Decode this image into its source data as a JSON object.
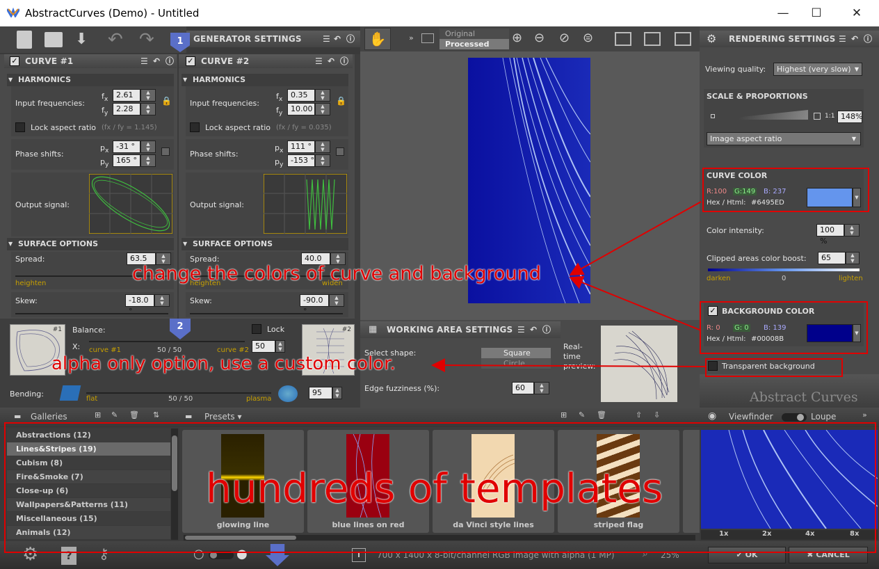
{
  "window": {
    "title": "AbstractCurves (Demo) - Untitled",
    "minimize": "—",
    "maximize": "☐",
    "close": "✕"
  },
  "generator": {
    "title": "GENERATOR SETTINGS",
    "badge1": "1",
    "badge2": "2"
  },
  "curve1": {
    "title": "CURVE #1",
    "harmonics": "HARMONICS",
    "input_freq_label": "Input frequencies:",
    "fx_label": "f",
    "fx_sub": "x",
    "fx": "2.61",
    "fy_label": "f",
    "fy_sub": "y",
    "fy": "2.28",
    "lock_aspect": "Lock aspect ratio",
    "aspect_note": "(fx / fy = 1.145)",
    "phase_label": "Phase shifts:",
    "px_label": "p",
    "px_sub": "x",
    "px": "-31 °",
    "py_label": "p",
    "py_sub": "y",
    "py": "165 °",
    "output_label": "Output signal:",
    "surface": "SURFACE OPTIONS",
    "spread_label": "Spread:",
    "spread": "63.5",
    "heighten": "heighten",
    "widen": "widen",
    "skew_label": "Skew:",
    "skew": "-18.0 °"
  },
  "curve2": {
    "title": "CURVE #2",
    "harmonics": "HARMONICS",
    "input_freq_label": "Input frequencies:",
    "fx_label": "f",
    "fx_sub": "x",
    "fx": "0.35",
    "fy_label": "f",
    "fy_sub": "y",
    "fy": "10.00",
    "lock_aspect": "Lock aspect ratio",
    "aspect_note": "(fx / fy = 0.035)",
    "phase_label": "Phase shifts:",
    "px_label": "p",
    "px_sub": "x",
    "px": "111 °",
    "py_label": "p",
    "py_sub": "y",
    "py": "-153 °",
    "output_label": "Output signal:",
    "surface": "SURFACE OPTIONS",
    "spread_label": "Spread:",
    "spread": "40.0",
    "heighten": "heighten",
    "widen": "widen",
    "skew_label": "Skew:",
    "skew": "-90.0 °"
  },
  "balance": {
    "label": "Balance:",
    "x_label": "X:",
    "curve1": "curve #1",
    "curve2": "curve #2",
    "mid": "50 / 50",
    "value": "50",
    "lock": "Lock",
    "thumb1": "#1",
    "thumb2": "#2"
  },
  "bending": {
    "label": "Bending:",
    "flat": "flat",
    "plasma": "plasma",
    "mid": "50 / 50",
    "value": "95"
  },
  "view": {
    "original": "Original",
    "processed": "Processed"
  },
  "working": {
    "title": "WORKING AREA SETTINGS",
    "shape_label": "Select shape:",
    "square": "Square",
    "circle": "Circle",
    "fuzz_label": "Edge fuzziness (%):",
    "fuzz": "60",
    "realtime": "Real-time preview:"
  },
  "rendering": {
    "title": "RENDERING SETTINGS",
    "quality_label": "Viewing quality:",
    "quality": "Highest (very slow)",
    "scale_title": "SCALE & PROPORTIONS",
    "ratio_label": "1:1",
    "scale": "148%",
    "aspect_select": "Image aspect ratio",
    "curve_color": {
      "title": "CURVE COLOR",
      "r": "R:100",
      "g": "G:149",
      "b": "B: 237",
      "hex_label": "Hex / Html:",
      "hex": "#6495ED",
      "swatch": "#6495ED"
    },
    "intensity_label": "Color intensity:",
    "intensity": "100 %",
    "boost_label": "Clipped areas color boost:",
    "boost": "65",
    "darken": "darken",
    "zero": "0",
    "lighten": "lighten",
    "bg_color": {
      "title": "BACKGROUND COLOR",
      "r": "R:  0",
      "g": "G:  0",
      "b": "B: 139",
      "hex_label": "Hex / Html:",
      "hex": "#00008B",
      "swatch": "#00008B"
    },
    "transparent": "Transparent background",
    "brand": "Abstract Curves"
  },
  "galleries": {
    "title": "Galleries",
    "items": [
      "Abstractions (12)",
      "Lines&Stripes (19)",
      "Cubism (8)",
      "Fire&Smoke (7)",
      "Close-up (6)",
      "Wallpapers&Patterns (11)",
      "Miscellaneous (15)",
      "Animals (12)"
    ]
  },
  "presets": {
    "title": "Presets",
    "items": [
      "glowing line",
      "blue lines on red",
      "da Vinci style lines",
      "striped flag"
    ]
  },
  "viewfinder": {
    "viewfinder": "Viewfinder",
    "loupe": "Loupe",
    "zooms": [
      "1x",
      "2x",
      "4x",
      "8x"
    ]
  },
  "status": {
    "info": "700 x 1400 x 8-bit/channel RGB image with alpha (1 MP)",
    "zoom": "25%",
    "ok": "OK",
    "cancel": "CANCEL"
  },
  "annotations": {
    "colors": "change the colors of curve and background",
    "alpha": "alpha only option, use a custom color.",
    "templates": "hundreds of templates"
  },
  "colors": {
    "annotation": "#e00000",
    "accent_gold": "#c8a000"
  }
}
